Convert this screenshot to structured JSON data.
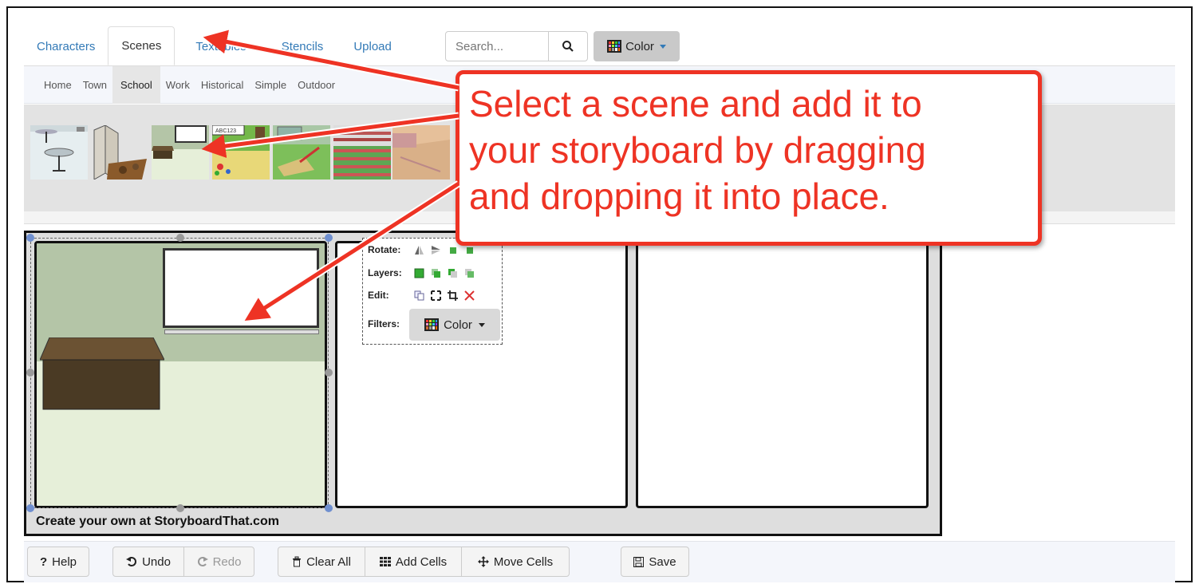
{
  "tabs": [
    {
      "label": "Characters"
    },
    {
      "label": "Scenes"
    },
    {
      "label": "Textables"
    },
    {
      "label": "Stencils"
    },
    {
      "label": "Upload"
    }
  ],
  "search": {
    "placeholder": "Search..."
  },
  "color_button": {
    "label": "Color"
  },
  "subtabs": [
    {
      "label": "Home"
    },
    {
      "label": "Town"
    },
    {
      "label": "School"
    },
    {
      "label": "Work"
    },
    {
      "label": "Historical"
    },
    {
      "label": "Simple"
    },
    {
      "label": "Outdoor"
    }
  ],
  "scene_thumbnails": [
    {
      "name": "cafeteria-tables-scene"
    },
    {
      "name": "lockers-scene"
    },
    {
      "name": "classroom-scene"
    },
    {
      "name": "alphabet-classroom-scene"
    },
    {
      "name": "playground-scene"
    },
    {
      "name": "track-field-scene"
    },
    {
      "name": "gym-scene"
    }
  ],
  "thumb_abc": "ABC123",
  "toolbox": {
    "rotate_label": "Rotate:",
    "layers_label": "Layers:",
    "edit_label": "Edit:",
    "filters_label": "Filters:",
    "filters_color": "Color"
  },
  "storyboard": {
    "watermark": "Create your own at StoryboardThat.com"
  },
  "bottom_toolbar": {
    "help": "Help",
    "undo": "Undo",
    "redo": "Redo",
    "clear_all": "Clear All",
    "add_cells": "Add Cells",
    "move_cells": "Move Cells",
    "save": "Save"
  },
  "callout": {
    "line1": "Select a scene and add it to",
    "line2": "your storyboard by dragging",
    "line3": "and dropping it into place."
  },
  "colors": {
    "link": "#337ab7",
    "callout": "#ee3324"
  }
}
